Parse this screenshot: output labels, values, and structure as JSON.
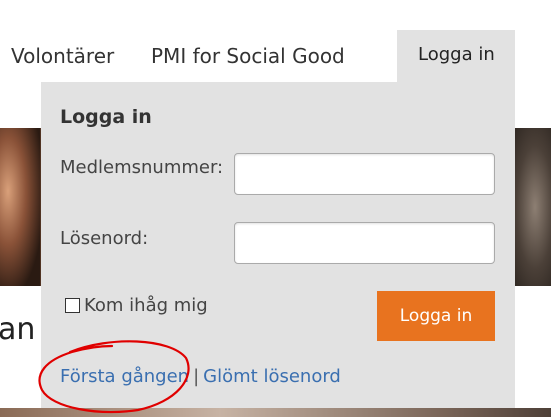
{
  "nav": {
    "items": [
      "Volontärer",
      "PMI for Social Good"
    ],
    "login_tab": "Logga in"
  },
  "background": {
    "partial_heading": "an"
  },
  "login_panel": {
    "title": "Logga in",
    "member_label": "Medlemsnummer:",
    "member_value": "",
    "password_label": "Lösenord:",
    "password_value": "",
    "remember_label": "Kom ihåg mig",
    "remember_checked": false,
    "submit_label": "Logga in",
    "first_time_link": "Första gången",
    "separator": "|",
    "forgot_link": "Glömt lösenord"
  },
  "colors": {
    "accent": "#e8731f",
    "link": "#3a6fb0",
    "panel_bg": "#e2e2e2",
    "annotation": "#e00000"
  }
}
